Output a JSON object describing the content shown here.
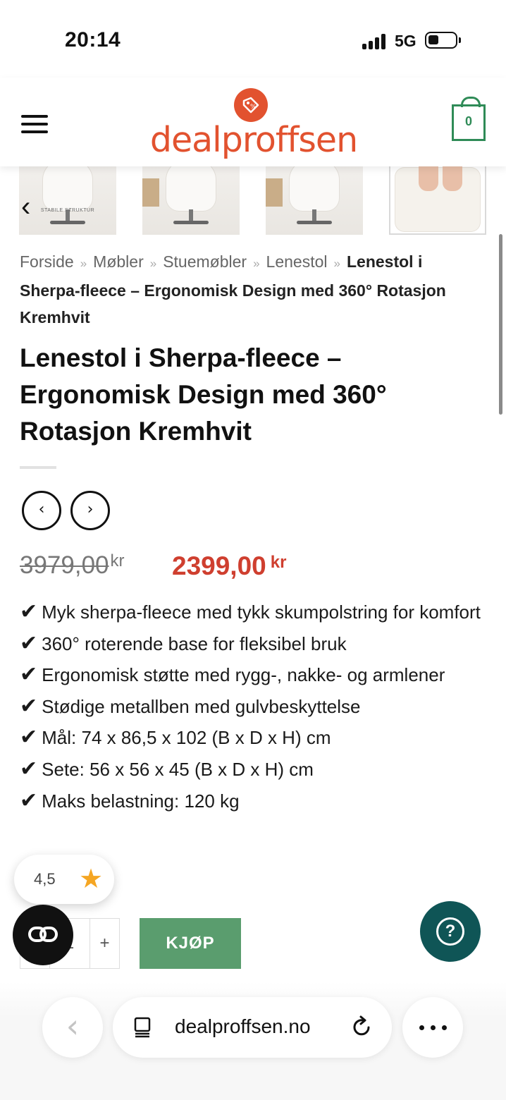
{
  "status_bar": {
    "time": "20:14",
    "network": "5G"
  },
  "header": {
    "logo_text": "dealproffsen",
    "cart_count": "0"
  },
  "gallery": {
    "thumb_caption": "STABILE STRUKTUR"
  },
  "breadcrumb": {
    "items": [
      "Forside",
      "Møbler",
      "Stuemøbler",
      "Lenestol"
    ],
    "separator": "»",
    "current": "Lenestol i Sherpa-fleece – Ergonomisk Design med 360° Rotasjon Kremhvit"
  },
  "product": {
    "title": "Lenestol i Sherpa-fleece – Ergonomisk Design med 360° Rotasjon Kremhvit",
    "old_price": "3979,00",
    "new_price": "2399,00",
    "currency": "kr",
    "check_mark": "✔",
    "features": [
      "Myk sherpa-fleece med tykk skumpolstring for komfort",
      "360° roterende base for fleksibel bruk",
      "Ergonomisk støtte med rygg-, nakke- og armlener",
      "Stødige metallben med gulvbeskyttelse",
      "Mål: 74 x 86,5 x 102 (B x D x H) cm",
      "Sete: 56 x 56 x 45 (B x D x H) cm",
      "Maks belastning: 120 kg"
    ]
  },
  "rating": {
    "value": "4,5",
    "star": "★"
  },
  "purchase": {
    "quantity": "1",
    "plus": "+",
    "buy_label": "KJØP"
  },
  "help": {
    "symbol": "?"
  },
  "browser": {
    "url": "dealproffsen.no",
    "back_glyph": "‹"
  },
  "nav": {
    "prev_glyph": "‹",
    "next_glyph": "›",
    "gallery_prev": "‹"
  },
  "colors": {
    "brand": "#e2522f",
    "sale": "#cf3f2f",
    "buy": "#5a9d6e",
    "cart": "#2f8b57",
    "help": "#0f5556"
  }
}
